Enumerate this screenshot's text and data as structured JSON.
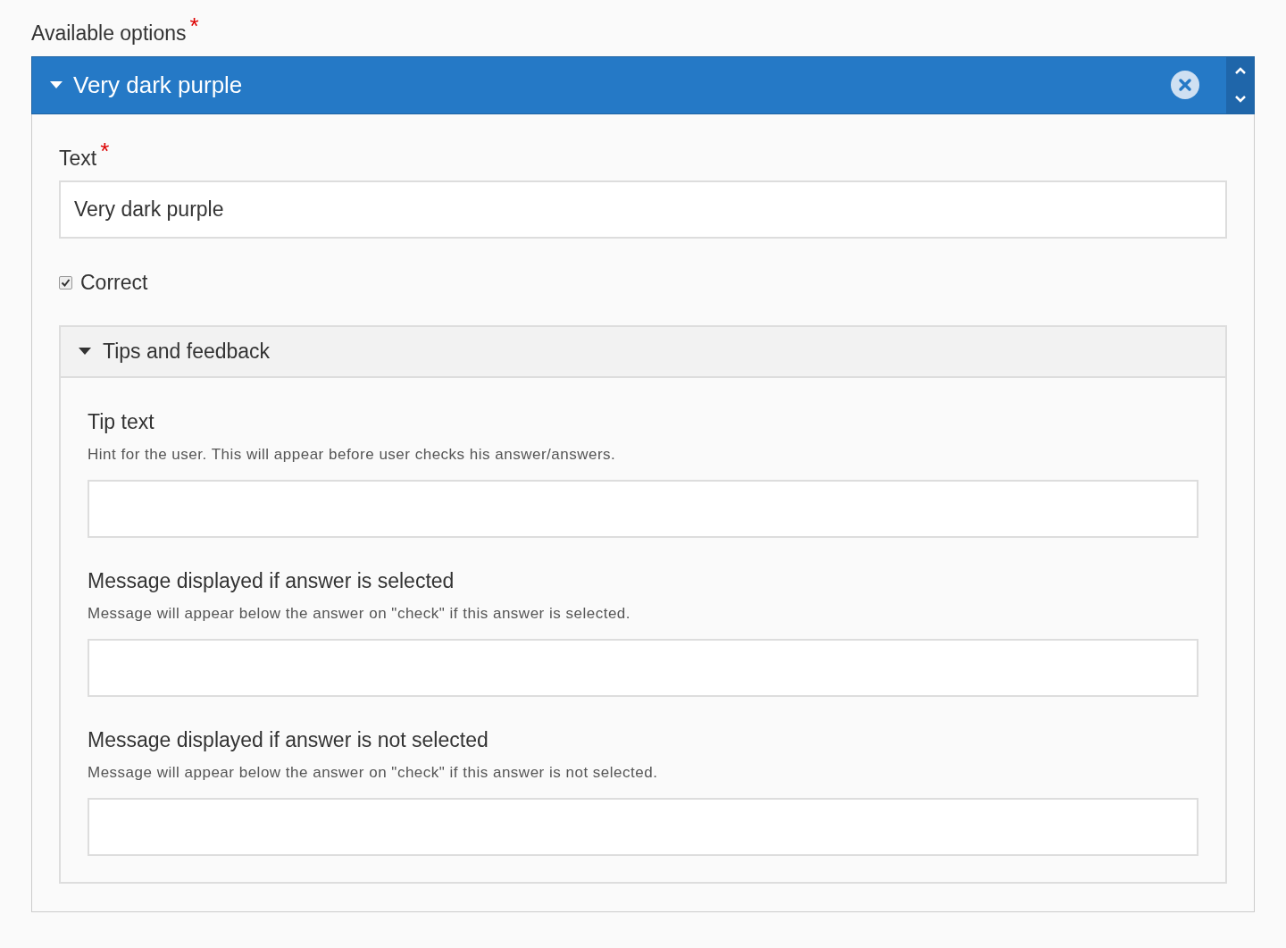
{
  "options": {
    "label": "Available options",
    "required": true,
    "required_mark": "*"
  },
  "item": {
    "title": "Very dark purple",
    "expanded": true,
    "text_field": {
      "label": "Text",
      "required": true,
      "required_mark": "*",
      "value": "Very dark purple"
    },
    "correct": {
      "label": "Correct",
      "checked": true
    },
    "feedback": {
      "title": "Tips and feedback",
      "expanded": true,
      "fields": [
        {
          "label": "Tip text",
          "description": "Hint for the user. This will appear before user checks his answer/answers."
        },
        {
          "label": "Message displayed if answer is selected",
          "description": "Message will appear below the answer on \"check\" if this answer is selected."
        },
        {
          "label": "Message displayed if answer is not selected",
          "description": "Message will appear below the answer on \"check\" if this answer is not selected."
        }
      ]
    }
  }
}
